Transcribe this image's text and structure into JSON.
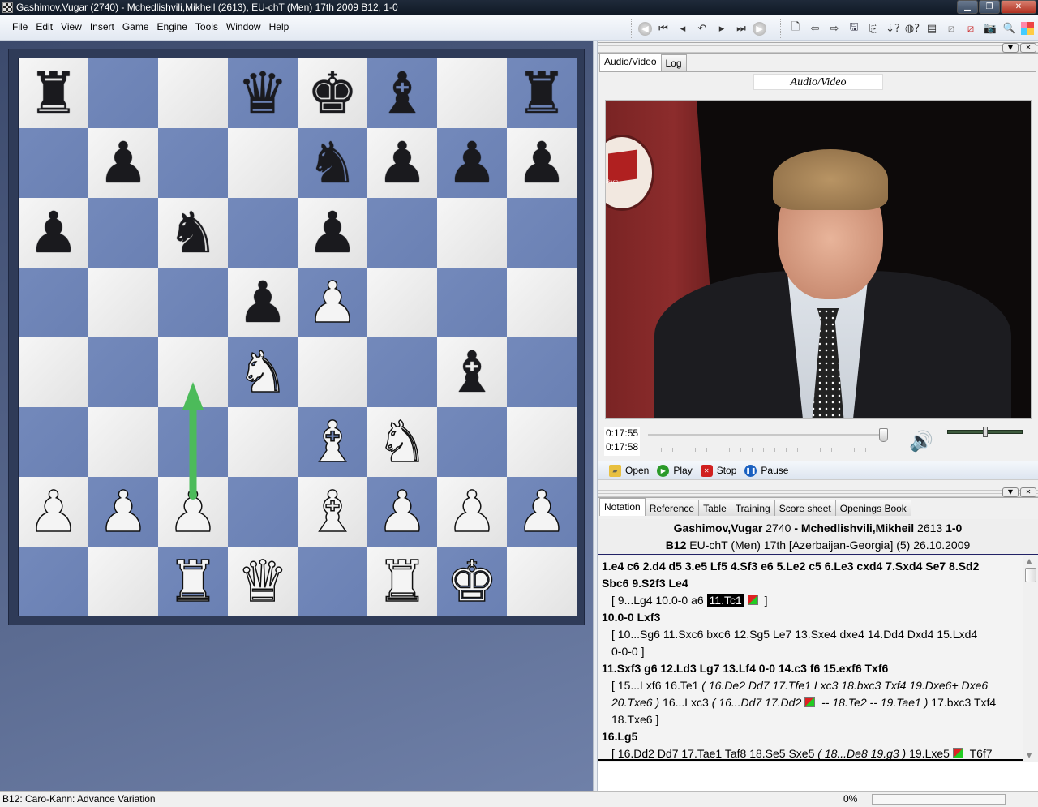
{
  "window": {
    "title": "Gashimov,Vugar (2740) - Mchedlishvili,Mikheil (2613), EU-chT (Men) 17th 2009  B12, 1-0",
    "controls": [
      "minimize",
      "restore",
      "close"
    ]
  },
  "menu": [
    "File",
    "Edit",
    "View",
    "Insert",
    "Game",
    "Engine",
    "Tools",
    "Window",
    "Help"
  ],
  "nav_toolbar": [
    "back-circle-icon",
    "first-move-icon",
    "prev-move-icon",
    "take-back-icon",
    "next-move-icon",
    "last-move-icon",
    "forward-circle-icon"
  ],
  "main_toolbar": [
    "new-document-icon",
    "arrow-left-icon",
    "arrow-right-icon",
    "save-icon",
    "save-as-icon",
    "sort-question-icon",
    "globe-question-icon",
    "properties-icon",
    "eraser-icon",
    "red-eraser-icon",
    "camera-icon",
    "search-document-icon",
    "color-grid-icon"
  ],
  "board": {
    "orientation": "white-bottom",
    "ranks": [
      [
        "r",
        "",
        "",
        "q",
        "k",
        "b",
        "",
        "r"
      ],
      [
        "",
        "p",
        "",
        "",
        "n",
        "p",
        "p",
        "p"
      ],
      [
        "p",
        "",
        "n",
        "",
        "p",
        "",
        "",
        ""
      ],
      [
        "",
        "",
        "",
        "p",
        "P",
        "",
        "",
        ""
      ],
      [
        "",
        "",
        "",
        "N",
        "",
        "",
        "b",
        ""
      ],
      [
        "",
        "",
        "",
        "",
        "B",
        "N",
        "",
        ""
      ],
      [
        "P",
        "P",
        "P",
        "",
        "B",
        "P",
        "P",
        "P"
      ],
      [
        "",
        "",
        "R",
        "Q",
        "",
        "R",
        "K",
        ""
      ]
    ],
    "arrow": {
      "from": "c2",
      "to": "c4",
      "color": "#4cbb5a"
    },
    "light_color": "#efefef",
    "dark_color": "#7087b8"
  },
  "av_pane": {
    "tabs": [
      "Audio/Video",
      "Log"
    ],
    "active_tab": 0,
    "header": "Audio/Video",
    "video_logo_text": "essBase",
    "time_current": "0:17:55",
    "time_total": "0:17:58",
    "seek_position": 0.98,
    "volume": 0.5,
    "controls": [
      {
        "label": "Open",
        "icon": "open-folder-icon"
      },
      {
        "label": "Play",
        "icon": "play-icon",
        "color": "#2a9a2a"
      },
      {
        "label": "Stop",
        "icon": "stop-icon",
        "color": "#d02020"
      },
      {
        "label": "Pause",
        "icon": "pause-icon",
        "color": "#1a60c0"
      }
    ]
  },
  "notation_pane": {
    "tabs": [
      "Notation",
      "Reference",
      "Table",
      "Training",
      "Score sheet",
      "Openings Book"
    ],
    "active_tab": 0,
    "header": {
      "white": "Gashimov,Vugar",
      "white_elo": "2740",
      "sep": "-",
      "black": "Mchedlishvili,Mikheil",
      "black_elo": "2613",
      "result": "1-0",
      "eco": "B12",
      "event": "EU-chT (Men) 17th [Azerbaijan-Georgia] (5) 26.10.2009"
    },
    "lines": {
      "l1": "1.e4  c6  2.d4  d5  3.e5  Lf5  4.Sf3  e6  5.Le2  c5  6.Le3  cxd4  7.Sxd4  Se7  8.Sd2",
      "l2": "Sbc6  9.S2f3  Le4",
      "l3a": "[ 9...Lg4  10.0-0  a6 ",
      "l3sel": "11.Tc1",
      "l3b": " ]",
      "l4": "10.0-0  Lxf3",
      "l5": "[ 10...Sg6  11.Sxc6  bxc6  12.Sg5  Le7  13.Sxe4  dxe4  14.Dd4  Dxd4  15.Lxd4",
      "l6": "0-0-0 ]",
      "l7": "11.Sxf3  g6  12.Ld3  Lg7  13.Lf4  0-0  14.c3  f6  15.exf6  Txf6",
      "l8a": "[ 15...Lxf6  16.Te1 ",
      "l8i": "( 16.De2  Dd7  17.Tfe1  Lxc3  18.bxc3  Txf4  19.Dxe6+  Dxe6",
      "l9i": "20.Txe6 )",
      "l9a": " 16...Lxc3 ",
      "l9i2": "( 16...Dd7  17.Dd2",
      "l9i3": " --  18.Te2  --  19.Tae1 )",
      "l9b": " 17.bxc3  Txf4",
      "l10": "18.Txe6 ]",
      "l11": "16.Lg5",
      "l12a": "[ 16.Dd2  Dd7  17.Tae1  Taf8  18.Se5  Sxe5 ",
      "l12i": "( 18...De8  19.g3 )",
      "l12b": " 19.Lxe5",
      "l12c": " T6f7"
    }
  },
  "status": {
    "text": "B12: Caro-Kann: Advance Variation",
    "progress_label": "0%",
    "progress": 0
  }
}
